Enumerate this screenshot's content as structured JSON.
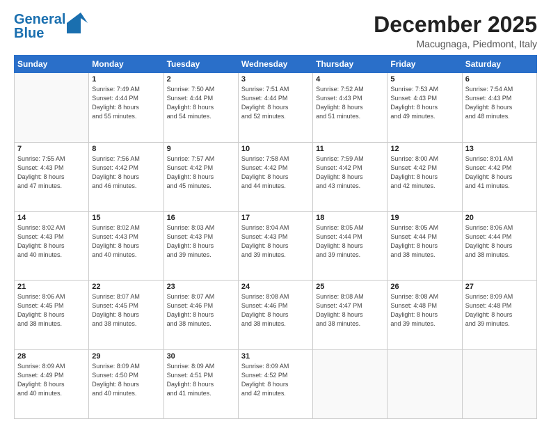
{
  "logo": {
    "line1": "General",
    "line2": "Blue"
  },
  "header": {
    "month": "December 2025",
    "location": "Macugnaga, Piedmont, Italy"
  },
  "weekdays": [
    "Sunday",
    "Monday",
    "Tuesday",
    "Wednesday",
    "Thursday",
    "Friday",
    "Saturday"
  ],
  "weeks": [
    [
      {
        "day": "",
        "info": ""
      },
      {
        "day": "1",
        "info": "Sunrise: 7:49 AM\nSunset: 4:44 PM\nDaylight: 8 hours\nand 55 minutes."
      },
      {
        "day": "2",
        "info": "Sunrise: 7:50 AM\nSunset: 4:44 PM\nDaylight: 8 hours\nand 54 minutes."
      },
      {
        "day": "3",
        "info": "Sunrise: 7:51 AM\nSunset: 4:44 PM\nDaylight: 8 hours\nand 52 minutes."
      },
      {
        "day": "4",
        "info": "Sunrise: 7:52 AM\nSunset: 4:43 PM\nDaylight: 8 hours\nand 51 minutes."
      },
      {
        "day": "5",
        "info": "Sunrise: 7:53 AM\nSunset: 4:43 PM\nDaylight: 8 hours\nand 49 minutes."
      },
      {
        "day": "6",
        "info": "Sunrise: 7:54 AM\nSunset: 4:43 PM\nDaylight: 8 hours\nand 48 minutes."
      }
    ],
    [
      {
        "day": "7",
        "info": "Sunrise: 7:55 AM\nSunset: 4:43 PM\nDaylight: 8 hours\nand 47 minutes."
      },
      {
        "day": "8",
        "info": "Sunrise: 7:56 AM\nSunset: 4:42 PM\nDaylight: 8 hours\nand 46 minutes."
      },
      {
        "day": "9",
        "info": "Sunrise: 7:57 AM\nSunset: 4:42 PM\nDaylight: 8 hours\nand 45 minutes."
      },
      {
        "day": "10",
        "info": "Sunrise: 7:58 AM\nSunset: 4:42 PM\nDaylight: 8 hours\nand 44 minutes."
      },
      {
        "day": "11",
        "info": "Sunrise: 7:59 AM\nSunset: 4:42 PM\nDaylight: 8 hours\nand 43 minutes."
      },
      {
        "day": "12",
        "info": "Sunrise: 8:00 AM\nSunset: 4:42 PM\nDaylight: 8 hours\nand 42 minutes."
      },
      {
        "day": "13",
        "info": "Sunrise: 8:01 AM\nSunset: 4:42 PM\nDaylight: 8 hours\nand 41 minutes."
      }
    ],
    [
      {
        "day": "14",
        "info": "Sunrise: 8:02 AM\nSunset: 4:43 PM\nDaylight: 8 hours\nand 40 minutes."
      },
      {
        "day": "15",
        "info": "Sunrise: 8:02 AM\nSunset: 4:43 PM\nDaylight: 8 hours\nand 40 minutes."
      },
      {
        "day": "16",
        "info": "Sunrise: 8:03 AM\nSunset: 4:43 PM\nDaylight: 8 hours\nand 39 minutes."
      },
      {
        "day": "17",
        "info": "Sunrise: 8:04 AM\nSunset: 4:43 PM\nDaylight: 8 hours\nand 39 minutes."
      },
      {
        "day": "18",
        "info": "Sunrise: 8:05 AM\nSunset: 4:44 PM\nDaylight: 8 hours\nand 39 minutes."
      },
      {
        "day": "19",
        "info": "Sunrise: 8:05 AM\nSunset: 4:44 PM\nDaylight: 8 hours\nand 38 minutes."
      },
      {
        "day": "20",
        "info": "Sunrise: 8:06 AM\nSunset: 4:44 PM\nDaylight: 8 hours\nand 38 minutes."
      }
    ],
    [
      {
        "day": "21",
        "info": "Sunrise: 8:06 AM\nSunset: 4:45 PM\nDaylight: 8 hours\nand 38 minutes."
      },
      {
        "day": "22",
        "info": "Sunrise: 8:07 AM\nSunset: 4:45 PM\nDaylight: 8 hours\nand 38 minutes."
      },
      {
        "day": "23",
        "info": "Sunrise: 8:07 AM\nSunset: 4:46 PM\nDaylight: 8 hours\nand 38 minutes."
      },
      {
        "day": "24",
        "info": "Sunrise: 8:08 AM\nSunset: 4:46 PM\nDaylight: 8 hours\nand 38 minutes."
      },
      {
        "day": "25",
        "info": "Sunrise: 8:08 AM\nSunset: 4:47 PM\nDaylight: 8 hours\nand 38 minutes."
      },
      {
        "day": "26",
        "info": "Sunrise: 8:08 AM\nSunset: 4:48 PM\nDaylight: 8 hours\nand 39 minutes."
      },
      {
        "day": "27",
        "info": "Sunrise: 8:09 AM\nSunset: 4:48 PM\nDaylight: 8 hours\nand 39 minutes."
      }
    ],
    [
      {
        "day": "28",
        "info": "Sunrise: 8:09 AM\nSunset: 4:49 PM\nDaylight: 8 hours\nand 40 minutes."
      },
      {
        "day": "29",
        "info": "Sunrise: 8:09 AM\nSunset: 4:50 PM\nDaylight: 8 hours\nand 40 minutes."
      },
      {
        "day": "30",
        "info": "Sunrise: 8:09 AM\nSunset: 4:51 PM\nDaylight: 8 hours\nand 41 minutes."
      },
      {
        "day": "31",
        "info": "Sunrise: 8:09 AM\nSunset: 4:52 PM\nDaylight: 8 hours\nand 42 minutes."
      },
      {
        "day": "",
        "info": ""
      },
      {
        "day": "",
        "info": ""
      },
      {
        "day": "",
        "info": ""
      }
    ]
  ]
}
